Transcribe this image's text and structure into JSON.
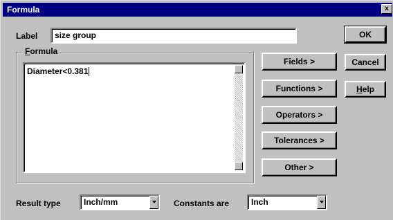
{
  "window": {
    "title": "Formula",
    "close_glyph": "x"
  },
  "label_field": {
    "label": "Label",
    "value": "size group"
  },
  "formula_group": {
    "title": "Formula",
    "mnemonic": "F",
    "rest": "ormula",
    "value": "Diameter<0.381"
  },
  "buttons": {
    "ok": "OK",
    "cancel": "Cancel",
    "help": "Help",
    "help_mnemonic": "H",
    "help_rest": "elp",
    "fields": "Fields >",
    "functions": "Functions >",
    "operators": "Operators >",
    "tolerances": "Tolerances >",
    "other": "Other >"
  },
  "result_type": {
    "label": "Result type",
    "value": "Inch/mm"
  },
  "constants": {
    "label": "Constants are",
    "value": "Inch"
  },
  "colors": {
    "titlebar": "#000080",
    "face": "#c0c0c0",
    "field": "#ffffff"
  }
}
